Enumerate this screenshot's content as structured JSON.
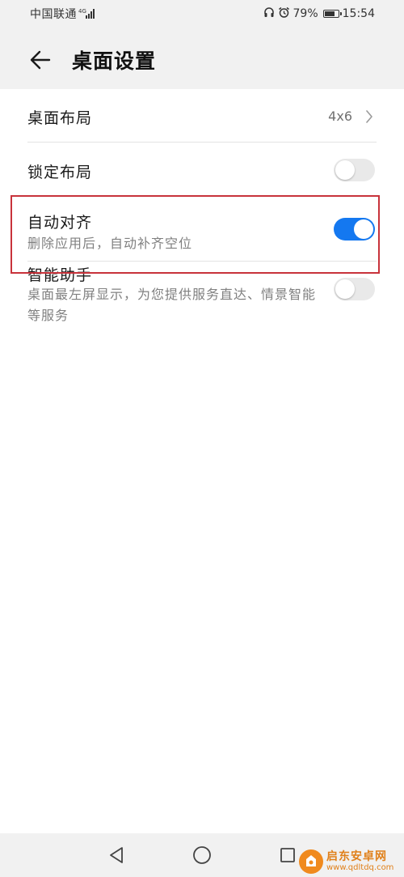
{
  "status_bar": {
    "carrier": "中国联通",
    "network_type": "4G",
    "signal_level": 4,
    "battery_percent": "79%",
    "battery_level": 0.79,
    "time": "15:54",
    "icons": [
      "headset-icon",
      "alarm-icon",
      "signal-icon",
      "battery-icon"
    ]
  },
  "header": {
    "title": "桌面设置",
    "back_icon": "arrow-left-icon"
  },
  "settings": {
    "layout": {
      "label": "桌面布局",
      "value": "4x6"
    },
    "lock_layout": {
      "label": "锁定布局",
      "enabled": false
    },
    "auto_align": {
      "label": "自动对齐",
      "description": "删除应用后，自动补齐空位",
      "enabled": true
    },
    "assistant": {
      "label": "智能助手",
      "description": "桌面最左屏显示，为您提供服务直达、情景智能等服务",
      "enabled": false
    }
  },
  "nav_bar": {
    "icons": [
      "triangle-back-icon",
      "circle-home-icon",
      "square-recent-icon"
    ]
  },
  "watermark": {
    "title": "启东安卓网",
    "url": "www.qdltdq.com"
  },
  "colors": {
    "accent": "#1478f0",
    "highlight": "#c8333b",
    "toggle_off": "#e9e9e9",
    "bar_background": "#f1f1f1",
    "watermark": "#e0801a"
  }
}
